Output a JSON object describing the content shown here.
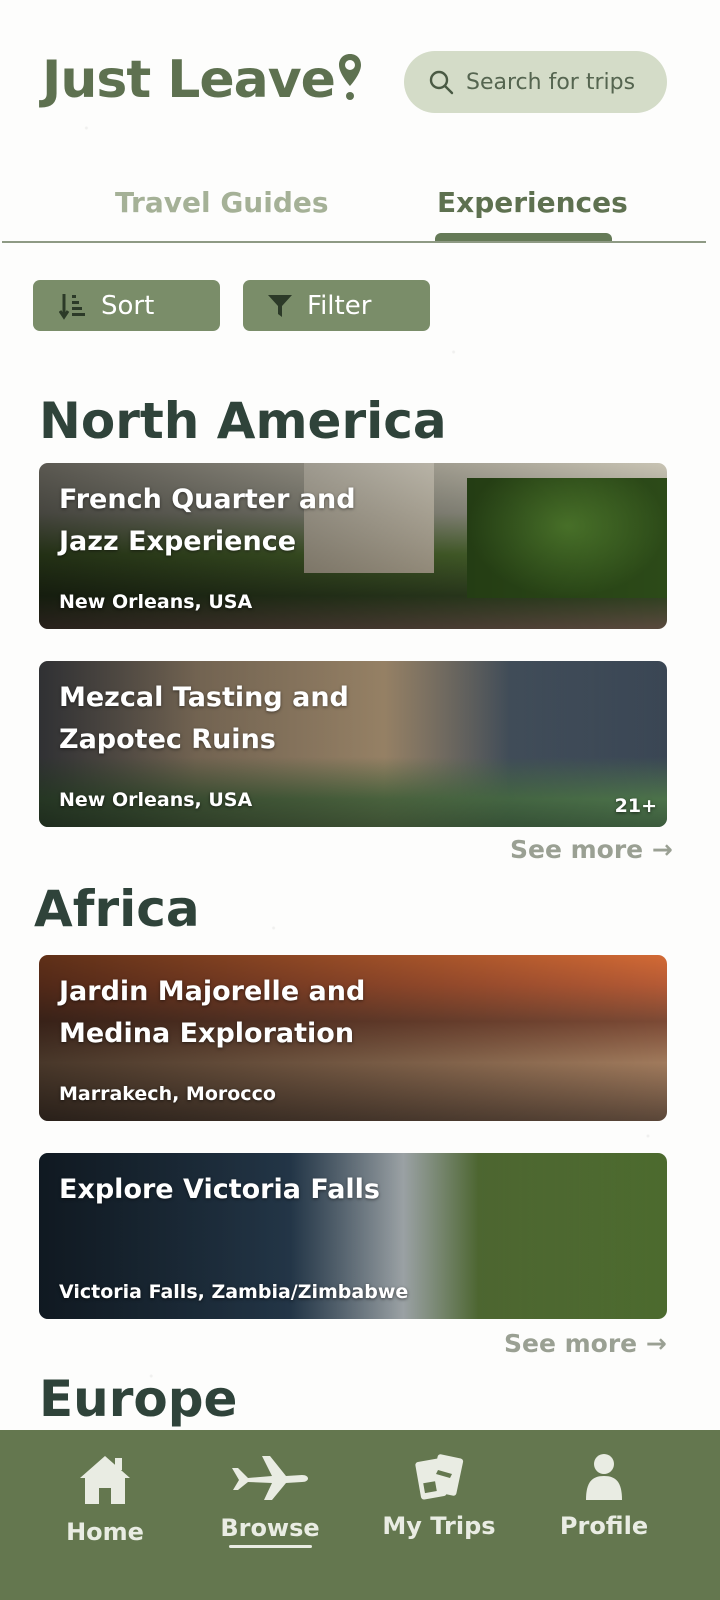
{
  "app": {
    "title": "Just Leave"
  },
  "search": {
    "placeholder": "Search for trips"
  },
  "tabs": [
    {
      "label": "Travel Guides",
      "active": false
    },
    {
      "label": "Experiences",
      "active": true
    }
  ],
  "toolbar": {
    "sort_label": "Sort",
    "filter_label": "Filter"
  },
  "sections": [
    {
      "title": "North America",
      "see_more": "See more →",
      "cards": [
        {
          "title": "French Quarter and Jazz Experience",
          "location": "New Orleans, USA",
          "badge": ""
        },
        {
          "title": "Mezcal Tasting and Zapotec Ruins",
          "location": "New Orleans, USA",
          "badge": "21+"
        }
      ]
    },
    {
      "title": "Africa",
      "see_more": "See more →",
      "cards": [
        {
          "title": "Jardin Majorelle and Medina Exploration",
          "location": "Marrakech, Morocco",
          "badge": ""
        },
        {
          "title": "Explore Victoria Falls",
          "location": "Victoria Falls, Zambia/Zimbabwe",
          "badge": ""
        }
      ]
    },
    {
      "title": "Europe"
    }
  ],
  "bottom_nav": {
    "items": [
      {
        "label": "Home",
        "icon": "home-icon",
        "active": false
      },
      {
        "label": "Browse",
        "icon": "airplane-icon",
        "active": true
      },
      {
        "label": "My Trips",
        "icon": "tickets-icon",
        "active": false
      },
      {
        "label": "Profile",
        "icon": "person-icon",
        "active": false
      }
    ]
  },
  "colors": {
    "brand_green": "#5e7150",
    "nav_green": "#64774f",
    "button_green": "#7a8d69",
    "search_bg": "#d4dcc8",
    "heading": "#2f433a"
  }
}
